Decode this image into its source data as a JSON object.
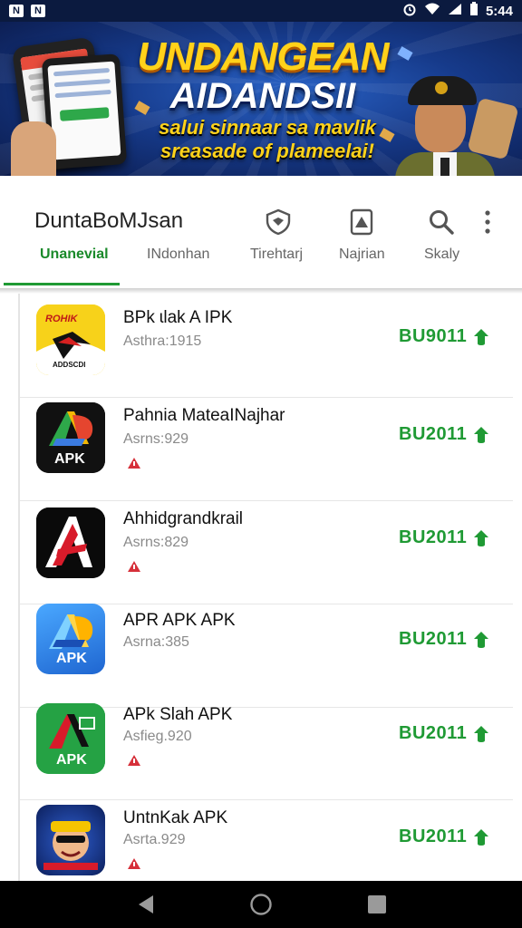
{
  "status_bar": {
    "left_icons": [
      "N",
      "N"
    ],
    "right_icons": [
      "alarm-icon",
      "wifi-icon",
      "signal-icon",
      "battery-icon"
    ],
    "time": "5:44"
  },
  "banner": {
    "title_line1": "UNDANGEAN",
    "title_line2": "AIDANDSII",
    "subtitle_line1": "salui sinnaar sa mavlik",
    "subtitle_line2": "sreasade of plameelai!"
  },
  "header": {
    "title": "DuntaBoMJsan",
    "icons": [
      "shield-icon",
      "card-icon",
      "search-icon",
      "more-vert-icon"
    ]
  },
  "tabs": [
    "Unanevial",
    "INdonhan",
    "Tirehtarj",
    "Najrian",
    "Skaly"
  ],
  "apps": [
    {
      "name": "BPk ɩlak A IPK",
      "size": "Asthra:1915",
      "action": "BU9011",
      "flag": false,
      "icon": "brand-yellow-icon"
    },
    {
      "name": "Pahnia MateaINajhar",
      "size": "Asrns:929",
      "action": "BU2011",
      "flag": true,
      "icon": "apk-rainbow-icon"
    },
    {
      "name": "Ahhidgrandkrail",
      "size": "Asrns:829",
      "action": "BU2011",
      "flag": true,
      "icon": "apk-red-black-icon"
    },
    {
      "name": "APR APK APK",
      "size": "Asrna:385",
      "action": "BU2011",
      "flag": false,
      "icon": "apk-blue-icon"
    },
    {
      "name": "APk Slah APK",
      "size": "Asfieg.920",
      "action": "BU2011",
      "flag": true,
      "icon": "apk-green-icon"
    },
    {
      "name": "UntnKak APK",
      "size": "Asrta.929",
      "action": "BU2011",
      "flag": true,
      "icon": "mascot-icon"
    }
  ],
  "icon_labels": {
    "apk_label": "APK",
    "brand_top": "ROHIK",
    "brand_bottom": "ADDSCDI"
  },
  "colors": {
    "accent": "#1f9a34",
    "status_bar": "#0b1a3f",
    "banner_yellow": "#ffd21a"
  },
  "nav": [
    "back-icon",
    "home-icon",
    "recents-icon"
  ]
}
